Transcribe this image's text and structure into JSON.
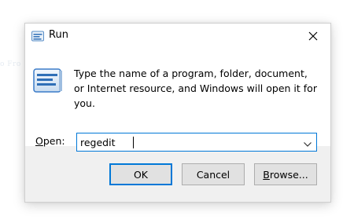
{
  "background_ghost_text": "o   Fro",
  "dialog": {
    "title": "Run",
    "message": "Type the name of a program, folder, document, or Internet resource, and Windows will open it for you.",
    "open_label_mnemonic": "O",
    "open_label_rest": "pen:",
    "input_value": "regedit",
    "buttons": {
      "ok": "OK",
      "cancel": "Cancel",
      "browse_mnemonic": "B",
      "browse_rest": "rowse..."
    }
  },
  "colors": {
    "accent": "#0078d7",
    "dialog_bg": "#f0f0f0",
    "button_bg": "#e1e1e1",
    "button_border": "#adadad"
  },
  "icons": [
    "run-icon",
    "close-icon",
    "run-program-icon",
    "chevron-down-icon"
  ]
}
